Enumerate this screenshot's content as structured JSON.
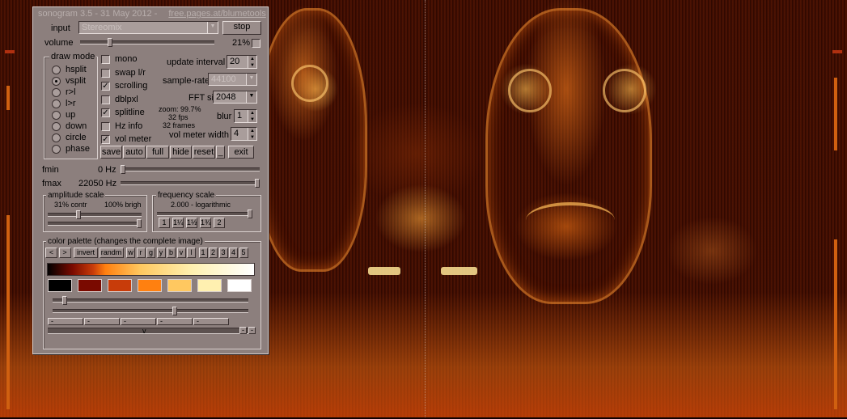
{
  "window": {
    "title": "sonogram 3.5 - 31 May 2012 -",
    "link": "free.pages.at/blumetools"
  },
  "input": {
    "label": "input",
    "value": "Stereomix",
    "stop_label": "stop"
  },
  "volume": {
    "label": "volume",
    "percent": "21%",
    "level": 0.21
  },
  "draw_mode": {
    "label": "draw mode",
    "options": [
      "hsplit",
      "vsplit",
      "r>l",
      "l>r",
      "up",
      "down",
      "circle",
      "phase"
    ],
    "selected": "vsplit"
  },
  "checks": [
    {
      "label": "mono",
      "checked": false
    },
    {
      "label": "swap l/r",
      "checked": false
    },
    {
      "label": "scrolling",
      "checked": true
    },
    {
      "label": "dblpxl",
      "checked": false
    },
    {
      "label": "splitline",
      "checked": true
    },
    {
      "label": "Hz info",
      "checked": false
    },
    {
      "label": "vol meter",
      "checked": true
    }
  ],
  "settings": {
    "update_interval_label": "update interval",
    "update_interval": "20",
    "sample_rate_label": "sample-rate",
    "sample_rate": "44100",
    "fft_label": "FFT size",
    "fft": "2048",
    "zoom": "zoom: 99.7%",
    "fps": "32 fps",
    "frames": "32 frames",
    "blur_label": "blur",
    "blur": "1",
    "vol_meter_width_label": "vol meter width",
    "vol_meter_width": "4"
  },
  "actions": [
    "save",
    "auto",
    "full",
    "hide",
    "reset",
    "_",
    "exit"
  ],
  "freq": {
    "fmin_label": "fmin",
    "fmin": "0 Hz",
    "fmax_label": "fmax",
    "fmax": "22050 Hz"
  },
  "amplitude": {
    "label": "amplitude scale",
    "contr": "31% contr",
    "brigh": "100% brigh"
  },
  "frequency_scale": {
    "label": "frequency scale",
    "value": "2.000 - logarithmic",
    "buttons": [
      "1",
      "1¼",
      "1½",
      "1¾",
      "2"
    ]
  },
  "palette": {
    "label": "color palette (changes the complete image)",
    "buttons": [
      "<",
      ">",
      "invert",
      "randm",
      "w",
      "r",
      "g",
      "y",
      "b",
      "v",
      "l",
      "1",
      "2",
      "3",
      "4",
      "5"
    ],
    "swatches": [
      "#000000",
      "#7a0a00",
      "#c83c0a",
      "#ff8010",
      "#ffc860",
      "#fff0b0",
      "#ffffff"
    ],
    "scroll_label": "v",
    "dashes": [
      "-",
      "-",
      "-",
      "-",
      "-"
    ]
  },
  "colors": {
    "panel": "#8c7f7d",
    "accent": "#ff8010"
  }
}
